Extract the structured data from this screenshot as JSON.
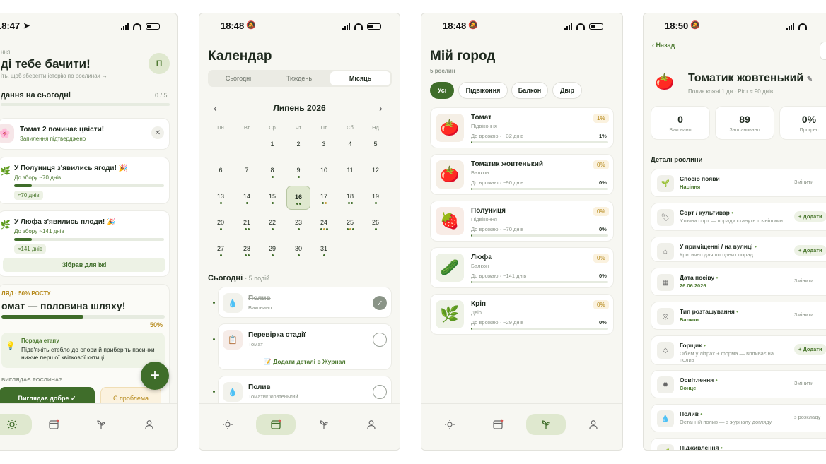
{
  "s1": {
    "time": "18:47",
    "greet_small": "ння",
    "greet_title": "ді тебе бачити!",
    "greet_sub": "іть, щоб зберегти історію по рослинах →",
    "avatar": "П",
    "tasks_label": "дання на сьогодні",
    "tasks_count": "0 / 5",
    "notif1_title": "Томат 2 починає цвісти!",
    "notif1_sub": "Запилення підтверджено",
    "notif2_title": "У Полуниця з'явились ягоди! 🎉",
    "notif2_sub": "До збору ~70 днів",
    "notif2_progress": 0.12,
    "notif2_badge": "≈70 днів",
    "notif3_title": "У Люфа з'явились плоди! 🎉",
    "notif3_sub": "До збору ~141 днів",
    "notif3_progress": 0.12,
    "notif3_badge": "≈141 днів",
    "harvest_btn": "Зібрав для їжі",
    "growth_label": "ЛЯД · 50% РОСТУ",
    "growth_title": "омат — половина шляху!",
    "growth_pct": "50%",
    "growth_progress": 0.5,
    "tip_title": "Порада етапу",
    "tip_text": "Підв'яжіть стебло до опори й приберіть пасинки нижче першої квіткової китиці.",
    "question": "ВИГЛЯДАЄ РОСЛИНА?",
    "btn_good": "Виглядає добре ✓",
    "btn_problem": "Є проблема"
  },
  "s2": {
    "time": "18:48",
    "title": "Календар",
    "seg": [
      "Сьогодні",
      "Тиждень",
      "Місяць"
    ],
    "month": "Липень 2026",
    "weekdays": [
      "Пн",
      "Вт",
      "Ср",
      "Чт",
      "Пт",
      "Сб",
      "Нд"
    ],
    "days": [
      "",
      "",
      "1",
      "2",
      "3",
      "4",
      "5",
      "6",
      "7",
      "8",
      "9",
      "10",
      "11",
      "12",
      "13",
      "14",
      "15",
      "16",
      "17",
      "18",
      "19",
      "20",
      "21",
      "22",
      "23",
      "24",
      "25",
      "26",
      "27",
      "28",
      "29",
      "30",
      "31"
    ],
    "today_label": "Сьогодні",
    "today_count": "· 5 подій",
    "ev1_title": "Полив",
    "ev1_sub": "Виконано",
    "ev2_title": "Перевірка стадії",
    "ev2_sub": "Томат",
    "ev2_link": "📝 Додати деталі в Журнал",
    "ev3_title": "Полив",
    "ev3_sub": "Томатик жовтенький"
  },
  "s3": {
    "time": "18:48",
    "title": "Мій город",
    "count": "5 рослин",
    "filters": [
      "Усі",
      "Підвіконня",
      "Балкон",
      "Двір"
    ],
    "plants": [
      {
        "name": "Томат",
        "place": "Підвіконня",
        "eta": "До врожаю · ~32 днів",
        "pct": "1%",
        "pct2": "1%",
        "progress": 0.01
      },
      {
        "name": "Томатик жовтенький",
        "place": "Балкон",
        "eta": "До врожаю · ~90 днів",
        "pct": "0%",
        "pct2": "0%",
        "progress": 0
      },
      {
        "name": "Полуниця",
        "place": "Підвіконня",
        "eta": "До врожаю · ~70 днів",
        "pct": "0%",
        "pct2": "0%",
        "progress": 0
      },
      {
        "name": "Люфа",
        "place": "Балкон",
        "eta": "До врожаю · ~141 днів",
        "pct": "0%",
        "pct2": "0%",
        "progress": 0
      },
      {
        "name": "Кріп",
        "place": "Двір",
        "eta": "До врожаю · ~29 днів",
        "pct": "0%",
        "pct2": "0%",
        "progress": 0
      }
    ]
  },
  "s4": {
    "time": "18:50",
    "back": "Назад",
    "title": "Томатик жовтенький",
    "subtitle": "Полив кожні 1 дн · Ріст ≈ 90 днів",
    "stats": [
      {
        "value": "0",
        "label": "Виконано"
      },
      {
        "value": "89",
        "label": "Заплановано"
      },
      {
        "value": "0%",
        "label": "Прогрес"
      }
    ],
    "section": "Деталі рослини",
    "rows": [
      {
        "title": "Спосіб появи",
        "value": "Насіння",
        "action": "Змінити"
      },
      {
        "title": "Сорт / культивар",
        "value": "Уточни сорт — поради стануть точнішими",
        "action": "+ Додати"
      },
      {
        "title": "У приміщенні / на вулиці",
        "value": "Критично для погодних порад",
        "action": "+ Додати"
      },
      {
        "title": "Дата посіву",
        "value": "26.06.2026",
        "action": "Змінити"
      },
      {
        "title": "Тип розташування",
        "value": "Балкон",
        "action": "Змінити"
      },
      {
        "title": "Горщик",
        "value": "Об'єм у літрах + форма — впливає на полив",
        "action": "+ Додати"
      },
      {
        "title": "Освітлення",
        "value": "Сонце",
        "action": "Змінити"
      },
      {
        "title": "Полив",
        "value": "Останній полив — з журналу догляду",
        "action": "з розкладу"
      },
      {
        "title": "Підживлення",
        "value": "",
        "action": "з розкладу"
      }
    ]
  }
}
